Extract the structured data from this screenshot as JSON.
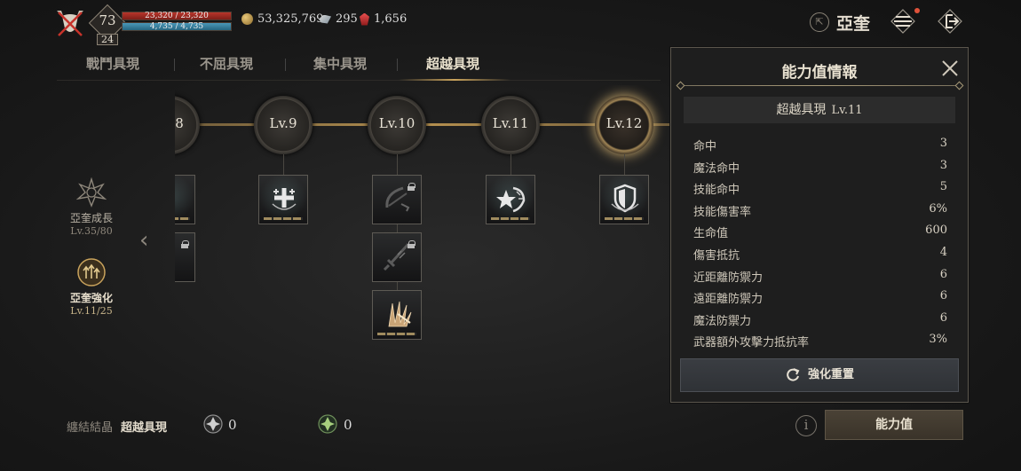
{
  "player": {
    "level": "73",
    "sublevel": "24",
    "hp": "23,320 / 23,320",
    "hp_fraction": 1.0,
    "mp": "4,735 / 4,735",
    "mp_fraction": 1.0
  },
  "currencies": {
    "gold": "53,325,769",
    "shards": "295",
    "gems": "1,656"
  },
  "header": {
    "server": "亞奎",
    "icons": [
      "share-icon",
      "menu-icon",
      "exit-icon"
    ]
  },
  "tabs": [
    "戰鬥具現",
    "不屈具現",
    "集中具現",
    "超越具現"
  ],
  "active_tab": "超越具現",
  "sidebar": {
    "items": [
      {
        "name": "亞奎成長",
        "sub": "Lv.35/80"
      },
      {
        "name": "亞奎強化",
        "sub": "Lv.11/25"
      }
    ]
  },
  "track": {
    "nodes": [
      {
        "label": "8"
      },
      {
        "label": "Lv.9"
      },
      {
        "label": "Lv.10"
      },
      {
        "label": "Lv.11"
      },
      {
        "label": "Lv.12"
      }
    ]
  },
  "panel": {
    "title": "能力值情報",
    "subtitle": "超越具現",
    "subtitle_level": "Lv.11",
    "stats": [
      {
        "name": "命中",
        "value": "3"
      },
      {
        "name": "魔法命中",
        "value": "3"
      },
      {
        "name": "技能命中",
        "value": "5"
      },
      {
        "name": "技能傷害率",
        "value": "6%"
      },
      {
        "name": "生命值",
        "value": "600"
      },
      {
        "name": "傷害抵抗",
        "value": "4"
      },
      {
        "name": "近距離防禦力",
        "value": "6"
      },
      {
        "name": "遠距離防禦力",
        "value": "6"
      },
      {
        "name": "魔法防禦力",
        "value": "6"
      },
      {
        "name": "武器額外攻擊力抵抗率",
        "value": "3%"
      }
    ],
    "reset_label": "強化重置"
  },
  "bottom": {
    "label_muted": "纏結結晶",
    "label_main": "超越具現",
    "crystal_a_count": "0",
    "crystal_b_count": "0",
    "stats_button": "能力值"
  },
  "colors": {
    "accent_gold": "#c9a35c",
    "hp_red": "#b8352b",
    "mp_blue": "#4a97b8"
  }
}
